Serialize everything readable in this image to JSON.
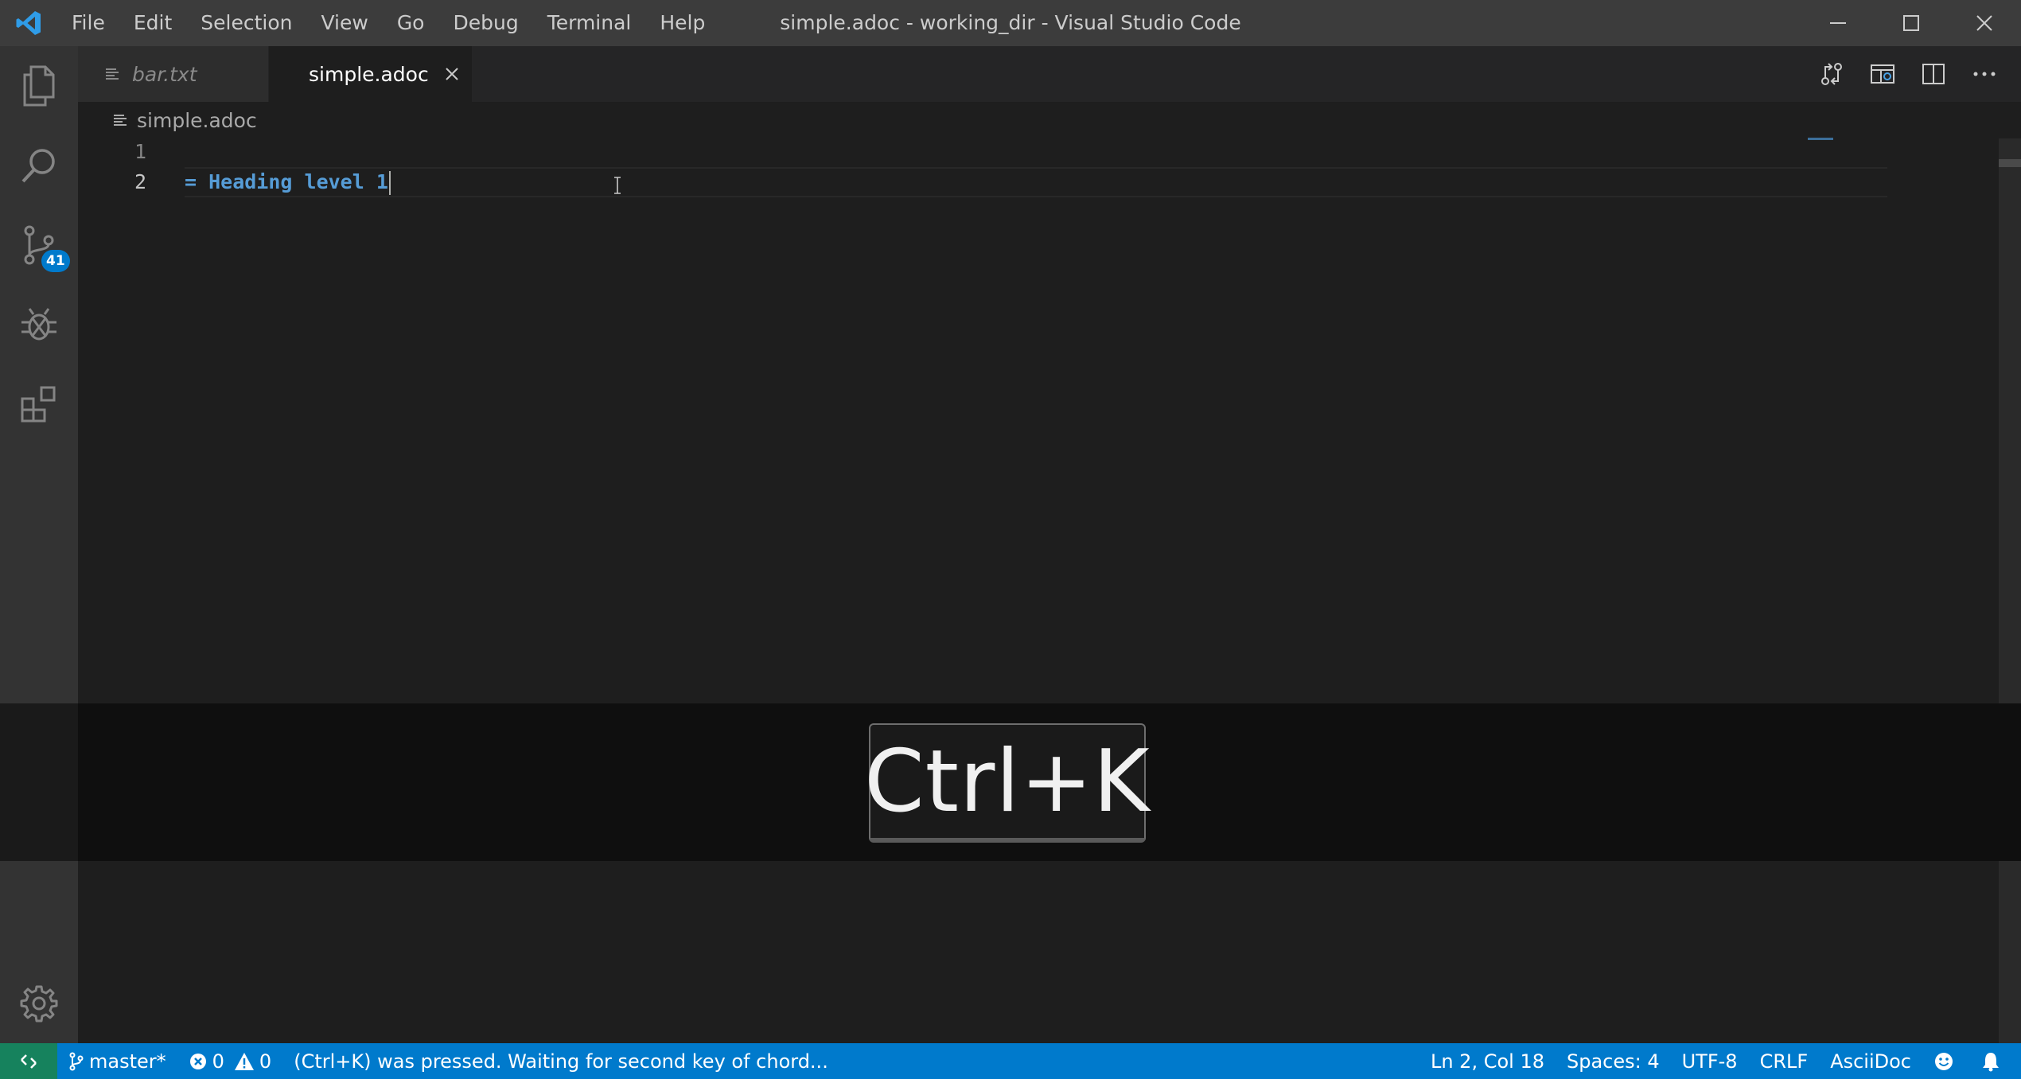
{
  "window": {
    "title": "simple.adoc - working_dir - Visual Studio Code"
  },
  "menu": [
    "File",
    "Edit",
    "Selection",
    "View",
    "Go",
    "Debug",
    "Terminal",
    "Help"
  ],
  "activity_bar": {
    "source_control_badge": "41"
  },
  "tabs": [
    {
      "label": "bar.txt",
      "active": false
    },
    {
      "label": "simple.adoc",
      "active": true
    }
  ],
  "breadcrumb": {
    "file": "simple.adoc"
  },
  "editor": {
    "line_numbers": [
      "1",
      "2"
    ],
    "lines": [
      "",
      "= Heading level 1"
    ]
  },
  "overlay": {
    "key": "Ctrl+K"
  },
  "status_bar": {
    "branch": "master*",
    "errors": "0",
    "warnings": "0",
    "message": "(Ctrl+K) was pressed. Waiting for second key of chord...",
    "cursor_position": "Ln 2, Col 18",
    "indentation": "Spaces: 4",
    "encoding": "UTF-8",
    "eol": "CRLF",
    "language": "AsciiDoc"
  },
  "colors": {
    "status_bar": "#007acc",
    "remote_button": "#16825d",
    "title_bar": "#3c3c3c",
    "activity_bar": "#333333",
    "editor_bg": "#1e1e1e",
    "heading_text": "#569cd6"
  }
}
